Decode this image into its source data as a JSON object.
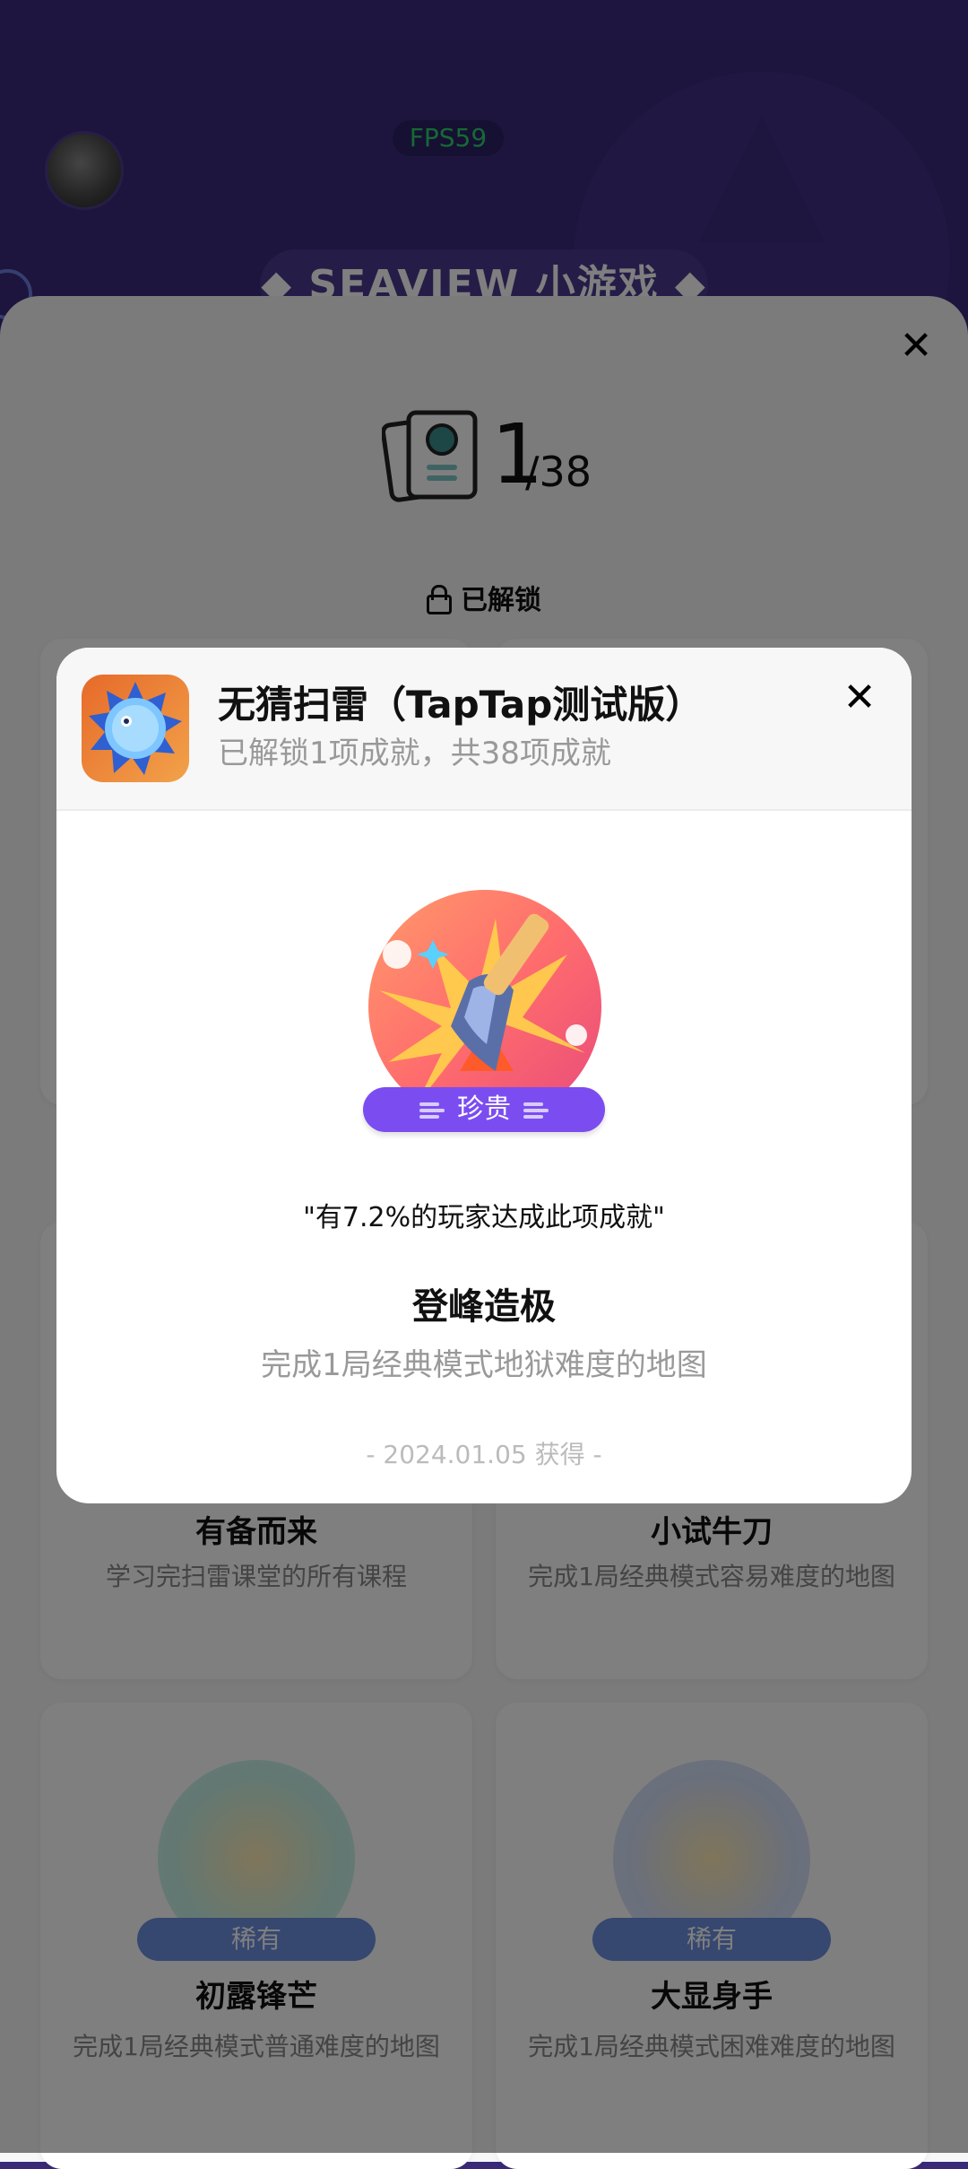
{
  "header": {
    "fps": "FPS59",
    "title": "◆ SEAVIEW 小游戏 ◆"
  },
  "sheet": {
    "count": "1",
    "total": "/38",
    "unlocked_label": "已解锁"
  },
  "cards": [
    {
      "name": "有备而来",
      "desc": "学习完扫雷课堂的所有课程"
    },
    {
      "name": "小试牛刀",
      "desc": "完成1局经典模式容易难度的地图"
    },
    {
      "name": "初露锋芒",
      "desc": "完成1局经典模式普通难度的地图",
      "rarity": "稀有"
    },
    {
      "name": "大显身手",
      "desc": "完成1局经典模式困难难度的地图",
      "rarity": "稀有"
    }
  ],
  "modal": {
    "game_title": "无猜扫雷（TapTap测试版）",
    "game_sub": "已解锁1项成就，共38项成就",
    "rarity": "珍贵",
    "percent_text": "\"有7.2%的玩家达成此项成就\"",
    "achievement_name": "登峰造极",
    "achievement_desc": "完成1局经典模式地狱难度的地图",
    "date_text": "- 2024.01.05 获得 -"
  },
  "colors": {
    "header_purple": "#3d2b80",
    "rarity_precious": "#7b4df0",
    "rarity_rare": "#6c8fe0",
    "fps_green": "#2fd06a"
  },
  "icons": [
    "avatar",
    "close-icon",
    "book-icon",
    "lock-icon",
    "mine-icon",
    "shovel-badge-icon"
  ]
}
